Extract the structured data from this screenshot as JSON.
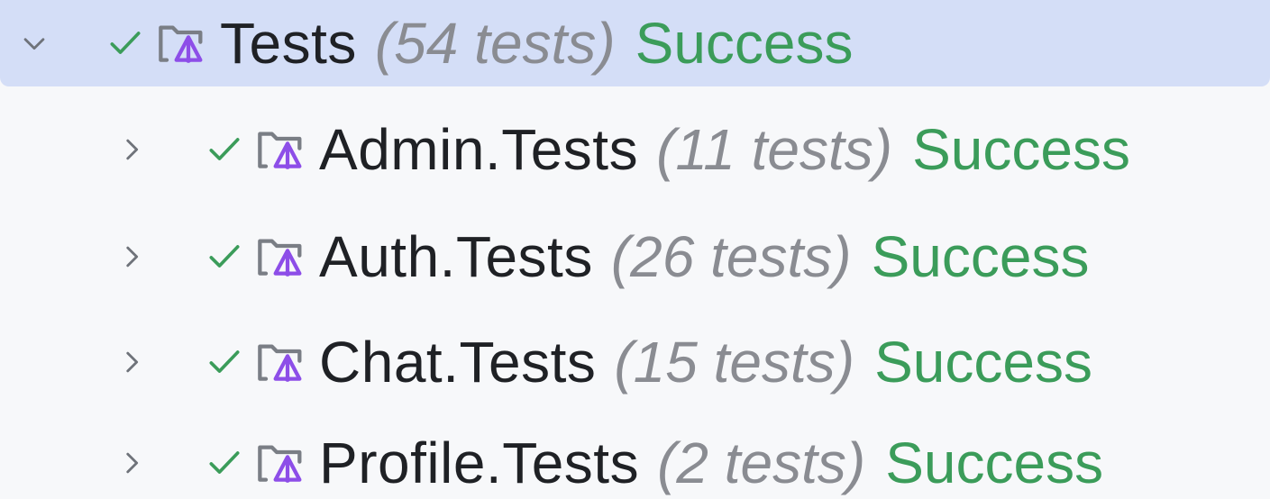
{
  "tree": {
    "root": {
      "name": "Tests",
      "count": "(54 tests)",
      "status": "Success",
      "expanded": true,
      "icons": {
        "toggle": "chevron-down-icon",
        "state": "checkmark-icon",
        "node": "test-folder-icon"
      }
    },
    "children": [
      {
        "name": "Admin.Tests",
        "count": "(11 tests)",
        "status": "Success"
      },
      {
        "name": "Auth.Tests",
        "count": "(26 tests)",
        "status": "Success"
      },
      {
        "name": "Chat.Tests",
        "count": "(15 tests)",
        "status": "Success"
      },
      {
        "name": "Profile.Tests",
        "count": "(2 tests)",
        "status": "Success"
      }
    ]
  },
  "colors": {
    "selection_background": "#d4def7",
    "success": "#3b9c5a",
    "count_text": "#8a8c92",
    "accent_icon": "#8d4ee8"
  }
}
